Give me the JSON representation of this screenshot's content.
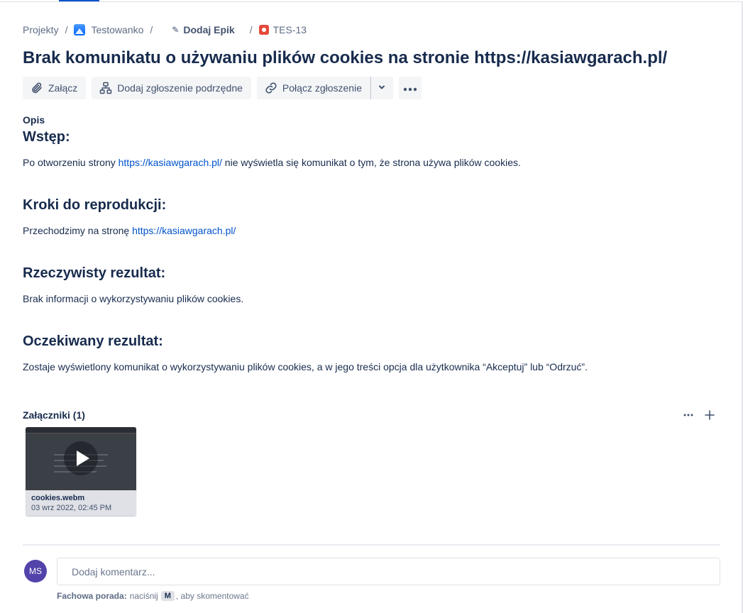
{
  "breadcrumb": {
    "projects": "Projekty",
    "project": "Testowanko",
    "epic": "Dodaj Epik",
    "issue_key": "TES-13",
    "separator": "/"
  },
  "issue": {
    "title": "Brak komunikatu o używaniu plików cookies na stronie https://kasiawgarach.pl/"
  },
  "toolbar": {
    "attach": "Załącz",
    "add_child": "Dodaj zgłoszenie podrzędne",
    "link_issue": "Połącz zgłoszenie"
  },
  "description": {
    "label": "Opis",
    "intro_heading": "Wstęp:",
    "intro_before": "Po otworzeniu strony ",
    "intro_link": "https://kasiawgarach.pl/",
    "intro_after": " nie wyświetla się komunikat o tym, że strona używa plików cookies.",
    "steps_heading": "Kroki do reprodukcji:",
    "steps_before": "Przechodzimy na stronę ",
    "steps_link": "https://kasiawgarach.pl/",
    "actual_heading": "Rzeczywisty rezultat:",
    "actual_text": "Brak informacji o wykorzystywaniu plików cookies.",
    "expected_heading": "Oczekiwany rezultat:",
    "expected_text": "Zostaje wyświetlony komunikat o wykorzystywaniu plików cookies, a w jego treści  opcja dla użytkownika “Akceptuj” lub “Odrzuć”."
  },
  "attachments": {
    "title": "Załączniki (1)",
    "items": [
      {
        "name": "cookies.webm",
        "date": "03 wrz 2022, 02:45 PM"
      }
    ]
  },
  "comment": {
    "avatar_initials": "MS",
    "placeholder": "Dodaj komentarz...",
    "tip_label": "Fachowa porada:",
    "tip_before": " naciśnij ",
    "tip_key": "M",
    "tip_after": ", aby skomentować"
  },
  "colors": {
    "link": "#0052cc",
    "avatar": "#5243aa",
    "bug": "#e5493a",
    "text": "#172b4d"
  }
}
